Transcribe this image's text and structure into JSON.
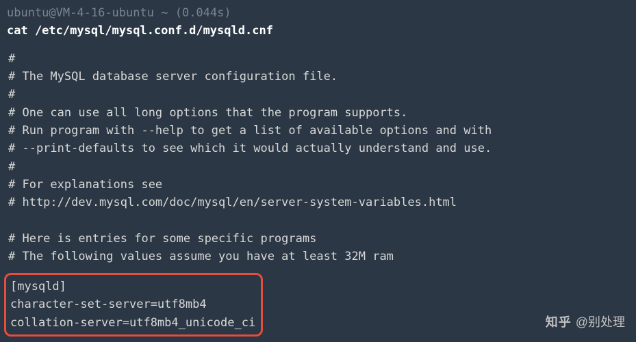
{
  "prompt": {
    "user": "ubuntu",
    "host": "VM-4-16-ubuntu",
    "path": "~",
    "timing": "(0.044s)"
  },
  "command": "cat /etc/mysql/mysql.conf.d/mysqld.cnf",
  "output": {
    "lines": [
      "#",
      "# The MySQL database server configuration file.",
      "#",
      "# One can use all long options that the program supports.",
      "# Run program with --help to get a list of available options and with",
      "# --print-defaults to see which it would actually understand and use.",
      "#",
      "# For explanations see",
      "# http://dev.mysql.com/doc/mysql/en/server-system-variables.html",
      "",
      "# Here is entries for some specific programs",
      "# The following values assume you have at least 32M ram"
    ],
    "highlighted": [
      "[mysqld]",
      "character-set-server=utf8mb4",
      "collation-server=utf8mb4_unicode_ci"
    ]
  },
  "watermark": {
    "site": "知乎",
    "handle": "@别处理"
  }
}
